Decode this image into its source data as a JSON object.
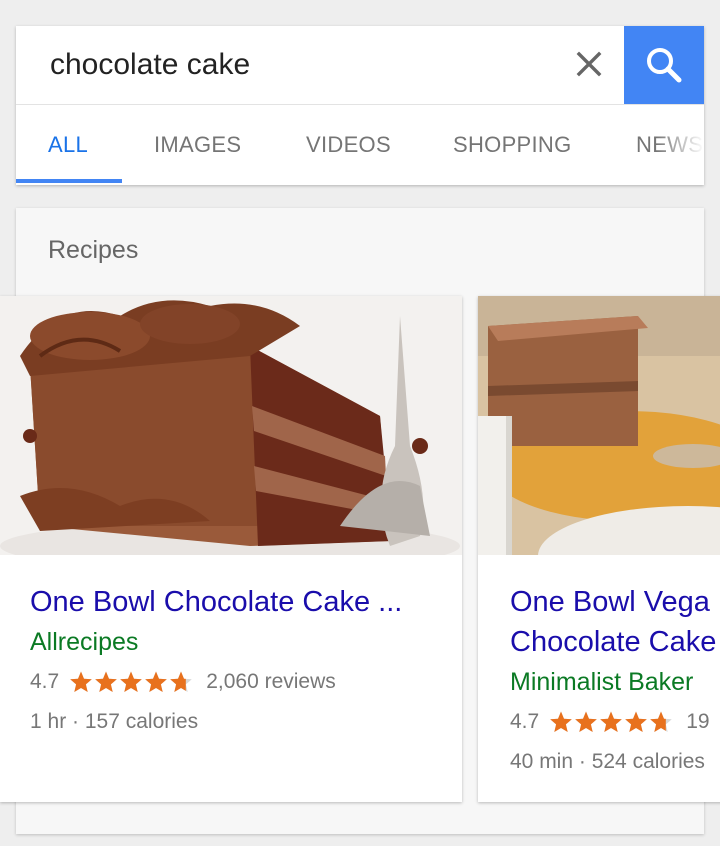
{
  "search": {
    "query": "chocolate cake"
  },
  "tabs": [
    {
      "label": "ALL"
    },
    {
      "label": "IMAGES"
    },
    {
      "label": "VIDEOS"
    },
    {
      "label": "SHOPPING"
    },
    {
      "label": "NEWS"
    }
  ],
  "recipes_section": {
    "title": "Recipes",
    "cards": [
      {
        "title": "One Bowl Chocolate Cake ...",
        "source": "Allrecipes",
        "rating": "4.7",
        "stars": 4.7,
        "reviews": "2,060 reviews",
        "meta": "1 hr · 157 calories"
      },
      {
        "title_line1": "One Bowl Vega",
        "title_line2": "Chocolate Cake",
        "source": "Minimalist Baker",
        "rating": "4.7",
        "stars": 4.7,
        "reviews": "19",
        "meta": "40 min · 524 calories"
      }
    ]
  },
  "colors": {
    "accent": "#4285f4",
    "link": "#1a0dab",
    "source": "#0b7a24",
    "star": "#e8711d"
  }
}
